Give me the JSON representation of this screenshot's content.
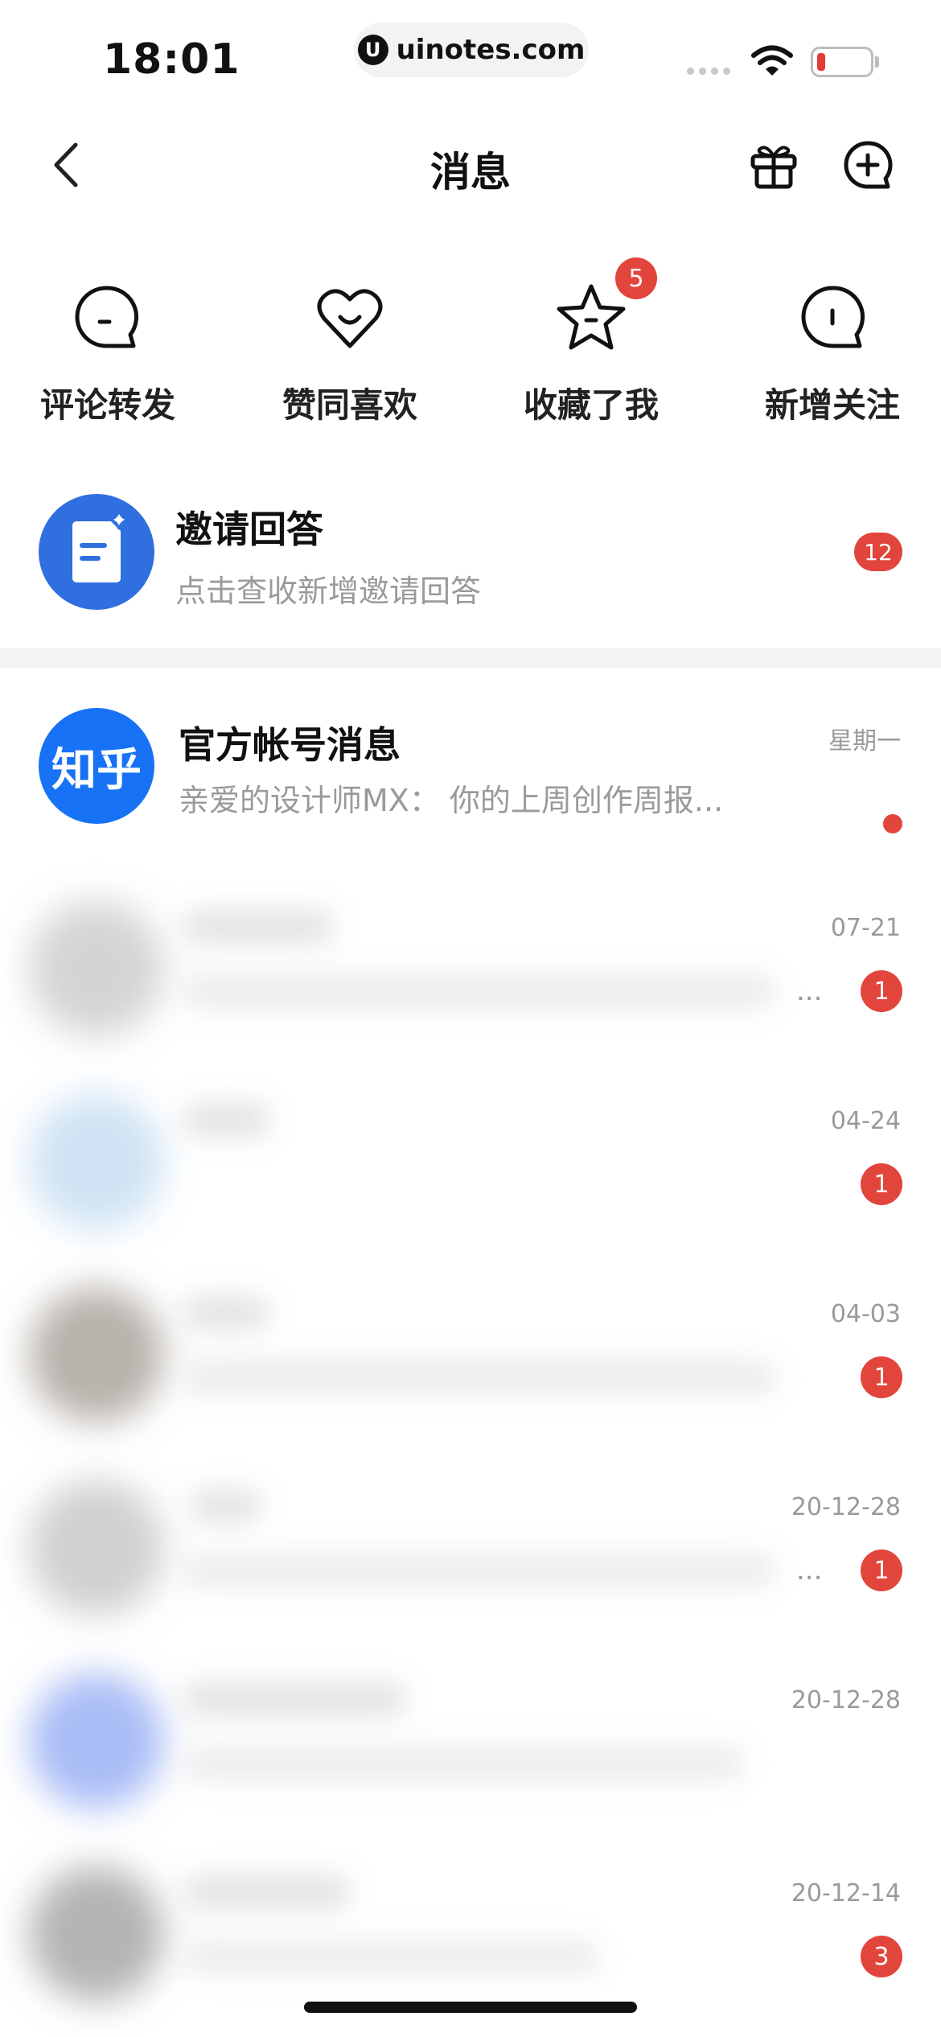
{
  "status_bar": {
    "time": "18:01",
    "url": "uinotes.com",
    "url_logo": "U",
    "battery_color": "#e53935"
  },
  "nav": {
    "back_icon": "chevron-left-icon",
    "title": "消息",
    "gift_icon": "gift-icon",
    "add_chat_icon": "add-chat-icon"
  },
  "quick_entries": [
    {
      "label": "评论转发",
      "icon": "comment-icon",
      "badge": ""
    },
    {
      "label": "赞同喜欢",
      "icon": "heart-icon",
      "badge": ""
    },
    {
      "label": "收藏了我",
      "icon": "star-icon",
      "badge": "5"
    },
    {
      "label": "新增关注",
      "icon": "follow-icon",
      "badge": ""
    }
  ],
  "invite": {
    "title": "邀请回答",
    "subtitle": "点击查收新增邀请回答",
    "badge": "12",
    "avatar_color": "#2f6fe0"
  },
  "messages": [
    {
      "name": "官方帐号消息",
      "avatar_text": "知乎",
      "preview": "亲爱的设计师MX： 你的上周创作周报...",
      "time": "星期一",
      "badge": "",
      "unread_dot": true
    },
    {
      "name": "",
      "preview": "",
      "time": "07-21",
      "badge": "1",
      "blurred": true
    },
    {
      "name": "",
      "preview": "",
      "time": "04-24",
      "badge": "1",
      "blurred": true
    },
    {
      "name": "",
      "preview": "",
      "time": "04-03",
      "badge": "1",
      "blurred": true
    },
    {
      "name": "",
      "preview": "",
      "time": "20-12-28",
      "badge": "1",
      "blurred": true
    },
    {
      "name": "",
      "preview": "",
      "time": "20-12-28",
      "badge": "",
      "blurred": true
    },
    {
      "name": "",
      "preview": "",
      "time": "20-12-14",
      "badge": "3",
      "blurred": true
    }
  ],
  "ellipsis": "...",
  "colors": {
    "accent_red": "#e2453c",
    "brand_blue": "#2f6fe0",
    "muted_text": "#9a9a9a"
  }
}
